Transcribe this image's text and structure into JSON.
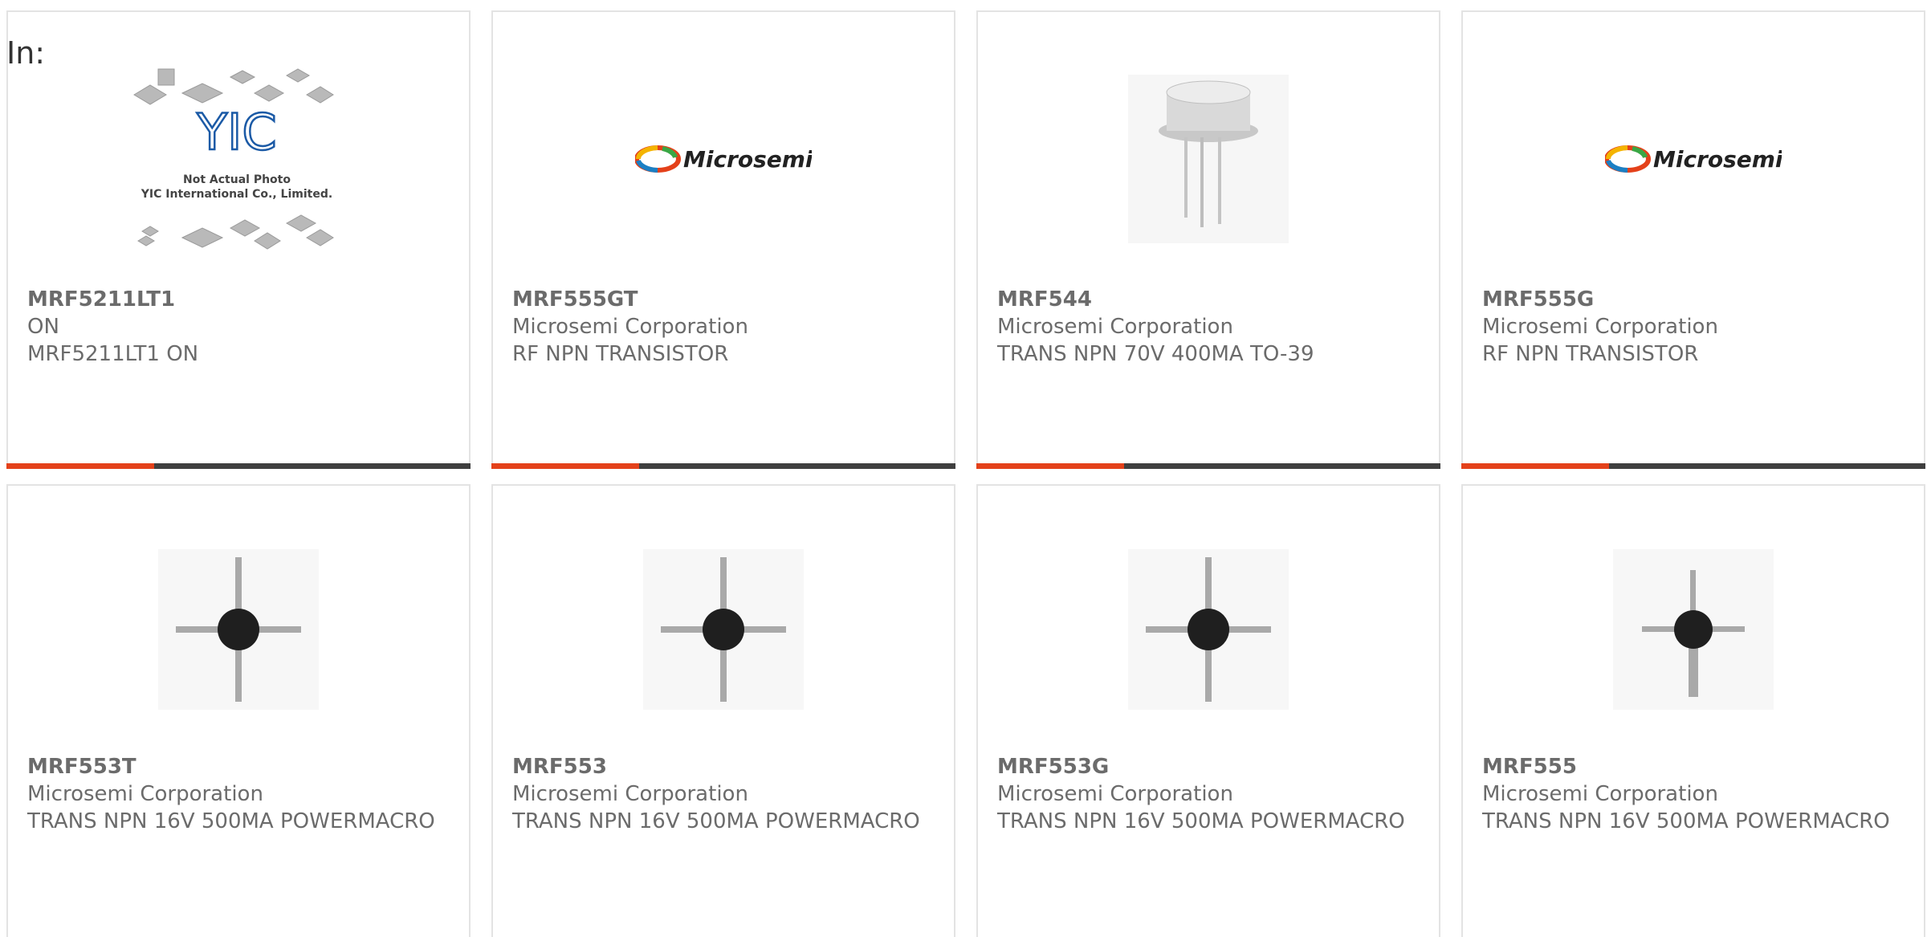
{
  "filter_label": "In:",
  "placeholder_image": {
    "caption_line1": "Not Actual Photo",
    "caption_line2": "YIC International Co., Limited.",
    "logo_text": "YIC"
  },
  "brand_logo_text": "Microsemi",
  "colors": {
    "accent": "#e4411a",
    "bar_dark": "#3f3f3f",
    "text": "#6b6b6b",
    "card_border": "#e3e3e3"
  },
  "products": [
    {
      "part": "MRF5211LT1",
      "manufacturer": "ON",
      "description": "MRF5211LT1 ON",
      "image": "placeholder-photo"
    },
    {
      "part": "MRF555GT",
      "manufacturer": "Microsemi Corporation",
      "description": "RF NPN TRANSISTOR",
      "image": "microsemi-logo"
    },
    {
      "part": "MRF544",
      "manufacturer": "Microsemi Corporation",
      "description": "TRANS NPN 70V 400MA TO-39",
      "image": "to39-can"
    },
    {
      "part": "MRF555G",
      "manufacturer": "Microsemi Corporation",
      "description": "RF NPN TRANSISTOR",
      "image": "microsemi-logo"
    },
    {
      "part": "MRF553T",
      "manufacturer": "Microsemi Corporation",
      "description": "TRANS NPN 16V 500MA POWERMACRO",
      "image": "powermacro"
    },
    {
      "part": "MRF553",
      "manufacturer": "Microsemi Corporation",
      "description": "TRANS NPN 16V 500MA POWERMACRO",
      "image": "powermacro"
    },
    {
      "part": "MRF553G",
      "manufacturer": "Microsemi Corporation",
      "description": "TRANS NPN 16V 500MA POWERMACRO",
      "image": "powermacro"
    },
    {
      "part": "MRF555",
      "manufacturer": "Microsemi Corporation",
      "description": "TRANS NPN 16V 500MA POWERMACRO",
      "image": "powermacro-small"
    }
  ]
}
